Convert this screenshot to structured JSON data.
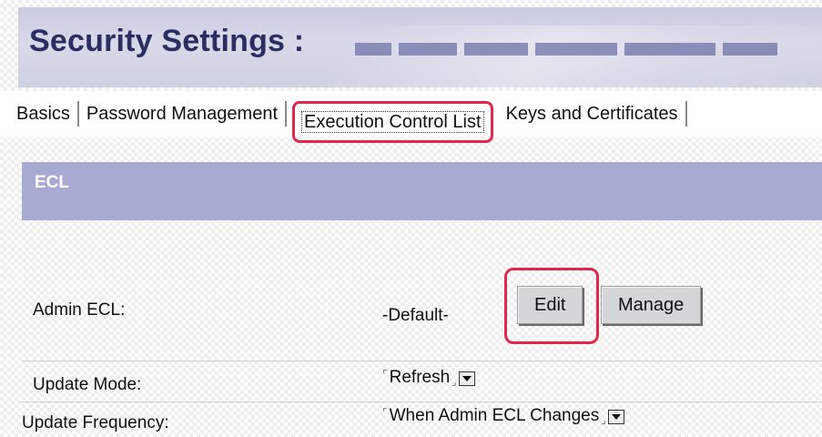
{
  "header": {
    "title": "Security Settings :"
  },
  "tabs": [
    {
      "label": "Basics"
    },
    {
      "label": "Password Management"
    },
    {
      "label": "Execution Control List",
      "active": true
    },
    {
      "label": "Keys and Certificates"
    }
  ],
  "section": {
    "title": "ECL"
  },
  "admin_ecl": {
    "label": "Admin ECL:",
    "value": "-Default-",
    "edit_label": "Edit",
    "manage_label": "Manage"
  },
  "update_mode": {
    "label": "Update Mode:",
    "value": "Refresh"
  },
  "update_frequency": {
    "label": "Update Frequency:",
    "value": "When Admin ECL Changes"
  },
  "colors": {
    "accent_highlight": "#e0284f",
    "section_header": "#a9aad2",
    "title_text": "#2b2e63"
  }
}
